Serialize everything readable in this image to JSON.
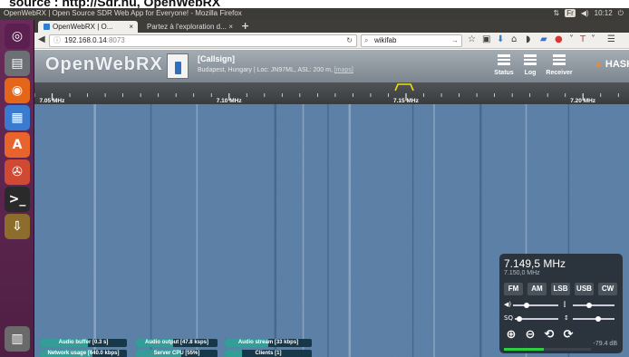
{
  "caption": "source : http://Sdr.hu, OpenWebRX",
  "os_topbar": {
    "window_title": "OpenWebRX | Open Source SDR Web App for Everyone! - Mozilla Firefox",
    "keyboard": "Fr",
    "volume": "◀)",
    "clock": "10:12",
    "power": "⏻"
  },
  "launcher": {
    "items": [
      {
        "name": "ubuntu-dash-icon",
        "glyph": "◎"
      },
      {
        "name": "files-icon",
        "glyph": "▤"
      },
      {
        "name": "firefox-icon",
        "glyph": "◉"
      },
      {
        "name": "writer-icon",
        "glyph": "▦"
      },
      {
        "name": "software-center-icon",
        "glyph": "A"
      },
      {
        "name": "settings-icon",
        "glyph": "✇"
      },
      {
        "name": "terminal-icon",
        "glyph": ">_"
      },
      {
        "name": "installer-icon",
        "glyph": "⇩"
      },
      {
        "name": "trash-icon",
        "glyph": "▥"
      }
    ]
  },
  "browser": {
    "tabs": [
      {
        "label": "OpenWebRX | O...",
        "close": "×",
        "active": true
      },
      {
        "label": "Partez à l'exploration d...",
        "close": "×",
        "active": false
      }
    ],
    "new_tab": "+",
    "url": "192.168.0.14",
    "url_port": ":8073",
    "search_value": "wikifab"
  },
  "header": {
    "logo": "OpenWebRX",
    "callsign": "[Callsign]",
    "location": "Budapest, Hungary | Loc: JN97ML, ASL: 200 m,",
    "map_link": "[maps]",
    "buttons": [
      {
        "label": "Status"
      },
      {
        "label": "Log"
      },
      {
        "label": "Receiver"
      }
    ],
    "sponsor": "HASKFU"
  },
  "scale": {
    "labels": [
      {
        "text": "7.05 MHz",
        "mhz": 7.05
      },
      {
        "text": "7.10 MHz",
        "mhz": 7.1
      },
      {
        "text": "7.15 MHz",
        "mhz": 7.15
      },
      {
        "text": "7.20 MHz",
        "mhz": 7.2
      }
    ],
    "range_mhz": [
      7.045,
      7.213
    ],
    "tuned_mhz": 7.1495,
    "passband_color": "#f2e100"
  },
  "waterfall": {
    "base_color": "#55789e",
    "signal_lines_mhz": [
      7.062,
      7.078,
      7.091,
      7.113,
      7.121,
      7.128,
      7.134,
      7.152,
      7.158,
      7.171,
      7.184,
      7.196
    ]
  },
  "tuner": {
    "frequency": "7.149,5 MHz",
    "sub_frequency": "7.150,0 MHz",
    "modes": [
      "FM",
      "AM",
      "LSB",
      "USB",
      "CW"
    ],
    "volume_icon": "◀)",
    "squelch_label": "SQ",
    "nr_icon": "⫿",
    "agc_icon": "↕",
    "zoom_in": "⊕",
    "zoom_out": "⊖",
    "zoom_reset": "⟲",
    "zoom_full": "⟳",
    "db_readout": "-79.4 dB",
    "smeter_level": 0.46,
    "sliders": {
      "volume": 0.3,
      "nr": 0.4,
      "squelch": 0.1,
      "agc": 0.6
    }
  },
  "progress": [
    {
      "label": "Audio buffer [0.3 s]",
      "level": 0.55
    },
    {
      "label": "Audio output [47.8 ksps]",
      "level": 0.45
    },
    {
      "label": "Audio stream [33 kbps]",
      "level": 0.5
    },
    {
      "label": "Network usage [640.0 kbps]",
      "level": 0.6
    },
    {
      "label": "Server CPU [55%]",
      "level": 0.55
    },
    {
      "label": "Clients [1]",
      "level": 0.2
    }
  ]
}
